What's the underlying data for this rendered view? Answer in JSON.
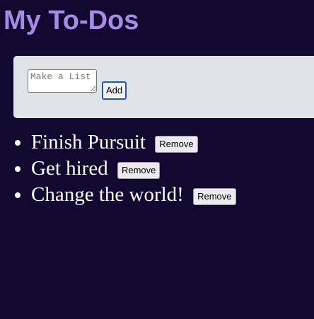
{
  "header": {
    "title": "My To-Dos"
  },
  "form": {
    "input_placeholder": "Make a List",
    "input_value": "",
    "add_label": "Add"
  },
  "todos": [
    {
      "text": "Finish Pursuit",
      "remove_label": "Remove"
    },
    {
      "text": "Get hired",
      "remove_label": "Remove"
    },
    {
      "text": "Change the world!",
      "remove_label": "Remove"
    }
  ],
  "colors": {
    "background": "#130830",
    "title": "#a78be8",
    "panel": "#e0e4e8",
    "add_button_border": "#1f5ba8",
    "item_text": "#ffffff"
  }
}
